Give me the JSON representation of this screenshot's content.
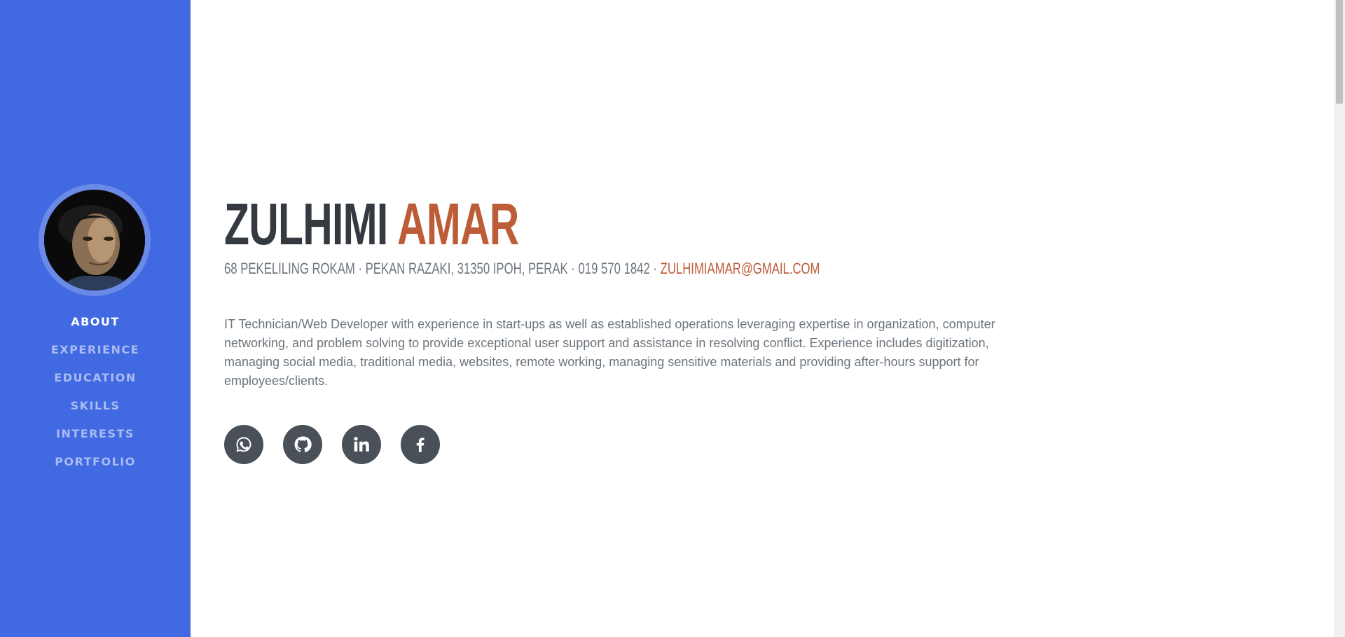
{
  "sidebar": {
    "background_color": "#4169e1",
    "avatar_alt": "profile photo",
    "nav": [
      {
        "label": "ABOUT",
        "active": true
      },
      {
        "label": "EXPERIENCE",
        "active": false
      },
      {
        "label": "EDUCATION",
        "active": false
      },
      {
        "label": "SKILLS",
        "active": false
      },
      {
        "label": "INTERESTS",
        "active": false
      },
      {
        "label": "PORTFOLIO",
        "active": false
      }
    ]
  },
  "about": {
    "first_name": "ZULHIMI",
    "last_name": "AMAR",
    "address": "68 PEKELILING ROKAM · PEKAN RAZAKI, 31350 IPOH, PERAK · 019 570 1842 · ",
    "email": "ZULHIMIAMAR@GMAIL.COM",
    "bio": "IT Technician/Web Developer with experience in start-ups as well as established operations leveraging expertise in organization, computer networking, and problem solving to provide exceptional user support and assistance in resolving conflict. Experience includes digitization, managing social media, traditional media, websites, remote working, managing sensitive materials and providing after-hours support for employees/clients.",
    "accent_color": "#bd5d38",
    "social": [
      {
        "icon": "whatsapp-icon"
      },
      {
        "icon": "github-icon"
      },
      {
        "icon": "linkedin-icon"
      },
      {
        "icon": "facebook-icon"
      }
    ]
  }
}
